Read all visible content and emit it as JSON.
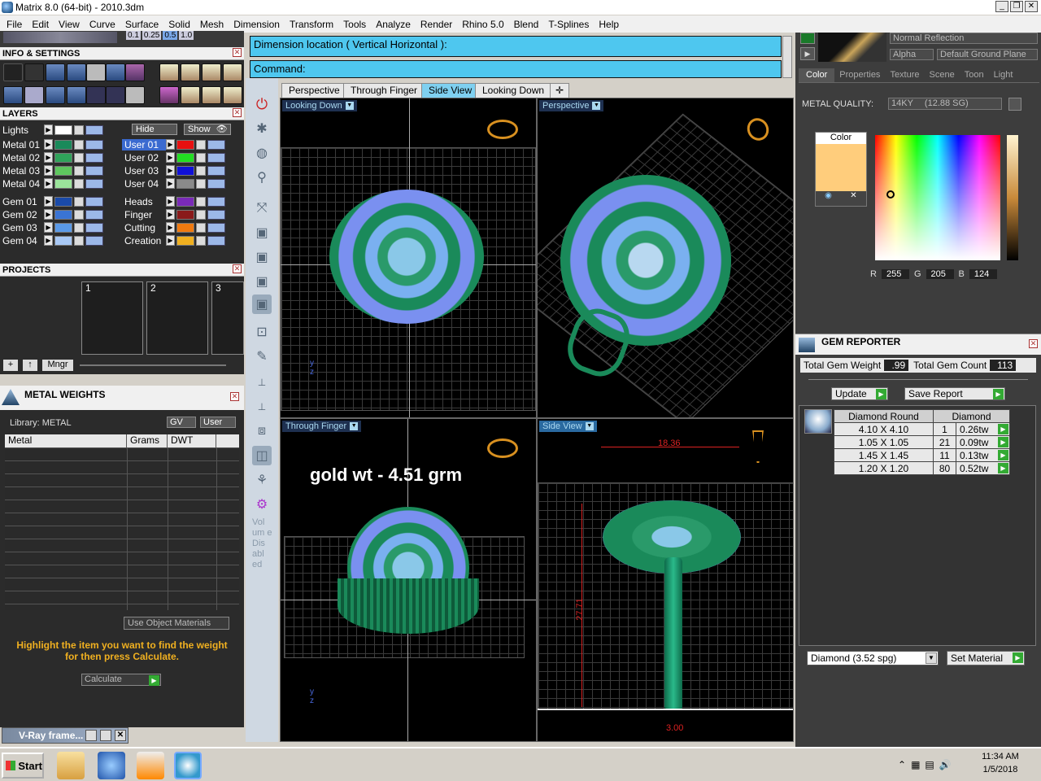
{
  "window": {
    "title": "Matrix 8.0 (64-bit) - 2010.3dm"
  },
  "menu": [
    "File",
    "Edit",
    "View",
    "Curve",
    "Surface",
    "Solid",
    "Mesh",
    "Dimension",
    "Transform",
    "Tools",
    "Analyze",
    "Render",
    "Rhino 5.0",
    "Blend",
    "T-Splines",
    "Help"
  ],
  "toolbar_top": {
    "values": [
      "0.1",
      "0.25",
      "0.5",
      "1.0"
    ]
  },
  "info_settings": {
    "title": "INFO & SETTINGS"
  },
  "layers": {
    "title": "LAYERS",
    "lights_label": "Lights",
    "hide_label": "Hide",
    "show_label": "Show",
    "left": [
      {
        "name": "Metal 01",
        "color": "#1a8a5a"
      },
      {
        "name": "Metal 02",
        "color": "#2fa35a"
      },
      {
        "name": "Metal 03",
        "color": "#5ec65e"
      },
      {
        "name": "Metal 04",
        "color": "#9be49b"
      },
      {
        "name": "Gem 01",
        "color": "#1a4aa8"
      },
      {
        "name": "Gem 02",
        "color": "#3a74d4"
      },
      {
        "name": "Gem 03",
        "color": "#5a9ae8"
      },
      {
        "name": "Gem 04",
        "color": "#a8c8f4"
      }
    ],
    "right": [
      {
        "name": "User 01",
        "color": "#e81010"
      },
      {
        "name": "User 02",
        "color": "#22dd22"
      },
      {
        "name": "User 03",
        "color": "#1010d8"
      },
      {
        "name": "User 04",
        "color": "#8a8a8a"
      },
      {
        "name": "Heads",
        "color": "#7a2ab8"
      },
      {
        "name": "Finger",
        "color": "#8a1a1a"
      },
      {
        "name": "Cutting",
        "color": "#f07a10"
      },
      {
        "name": "Creation",
        "color": "#f0b020"
      }
    ]
  },
  "projects": {
    "title": "PROJECTS",
    "slots": [
      "1",
      "2",
      "3"
    ],
    "mngr_label": "Mngr"
  },
  "metal_weights": {
    "title": "METAL WEIGHTS",
    "library_label": "Library: METAL",
    "gv_label": "GV",
    "user_label": "User",
    "columns": [
      "Metal",
      "Grams",
      "DWT"
    ],
    "use_object_materials": "Use Object Materials",
    "hint": "Highlight the item you want to find the weight for then press Calculate.",
    "calculate_label": "Calculate"
  },
  "vray": {
    "label": "V-Ray frame..."
  },
  "command": {
    "prompt": "Dimension location ( Vertical  Horizontal ):",
    "label": "Command:"
  },
  "tabs": [
    "Perspective",
    "Through Finger",
    "Side View",
    "Looking Down"
  ],
  "tabs_active": "Side View",
  "viewports": {
    "top_left": "Looking Down",
    "top_right": "Perspective",
    "bottom_left": "Through Finger",
    "bottom_right": "Side View"
  },
  "overlay_text": "gold wt - 4.51 grm",
  "dimensions": {
    "width": "18.36",
    "height": "27.71",
    "base": "3.00"
  },
  "tool_sidebar": {
    "volume_text": "Vol um e Dis abl ed"
  },
  "render_panel": {
    "reflection": "Normal Reflection",
    "alpha_label": "Alpha",
    "ground_plane": "Default Ground Plane",
    "tabs": [
      "Color",
      "Properties",
      "Texture",
      "Scene",
      "Toon",
      "Light"
    ],
    "metal_quality_label": "METAL QUALITY:",
    "metal_quality_value": "14KY",
    "metal_quality_sg": "(12.88 SG)",
    "color_label": "Color",
    "color_hex": "#ffcd7c",
    "rgb": {
      "r_label": "R",
      "r": "255",
      "g_label": "G",
      "g": "205",
      "b_label": "B",
      "b": "124"
    }
  },
  "gem_reporter": {
    "title": "GEM REPORTER",
    "total_weight_label": "Total Gem Weight",
    "total_weight": ".99",
    "total_count_label": "Total Gem Count",
    "total_count": "113",
    "update_label": "Update",
    "save_report_label": "Save Report",
    "headers": [
      "Diamond Round",
      "Diamond"
    ],
    "rows": [
      {
        "size": "4.10 X 4.10",
        "count": "1",
        "tw": "0.26tw"
      },
      {
        "size": "1.05 X 1.05",
        "count": "21",
        "tw": "0.09tw"
      },
      {
        "size": "1.45 X 1.45",
        "count": "11",
        "tw": "0.13tw"
      },
      {
        "size": "1.20 X 1.20",
        "count": "80",
        "tw": "0.52tw"
      }
    ],
    "material_select": "Diamond    (3.52 spg)",
    "set_material_label": "Set Material"
  },
  "taskbar": {
    "start": "Start",
    "time": "11:34 AM",
    "date": "1/5/2018"
  }
}
